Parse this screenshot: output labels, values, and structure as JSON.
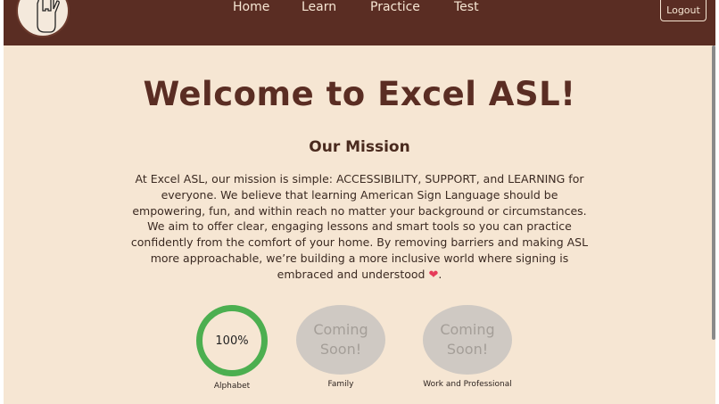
{
  "nav": {
    "links": [
      "Home",
      "Learn",
      "Practice",
      "Test"
    ],
    "logout_label": "Logout"
  },
  "main": {
    "title": "Welcome to Excel ASL!",
    "mission_heading": "Our Mission",
    "mission_text": "At Excel ASL, our mission is simple: ACCESSIBILITY, SUPPORT, and LEARNING for everyone. We believe that learning American Sign Language should be empowering, fun, and within reach no matter your background or circumstances. We aim to offer clear, engaging lessons and smart tools so you can practice confidently from the comfort of your home. By removing barriers and making ASL more approachable, we’re building a more inclusive world where signing is embraced and understood",
    "mission_heart": "❤",
    "mission_end": "."
  },
  "progress": [
    {
      "label": "Alphabet",
      "status": "100%",
      "percent": 100
    },
    {
      "label": "Family",
      "status_line1": "Coming",
      "status_line2": "Soon!"
    },
    {
      "label": "Work and Professional",
      "status_line1": "Coming",
      "status_line2": "Soon!"
    }
  ],
  "colors": {
    "navbar": "#5a2d23",
    "background": "#f6e6d3",
    "progress_complete": "#4caf50",
    "coming_soon": "#cfc9c3",
    "heart": "#e63b5a"
  },
  "icons": {
    "logo": "asl-i-love-you-hand-icon"
  }
}
